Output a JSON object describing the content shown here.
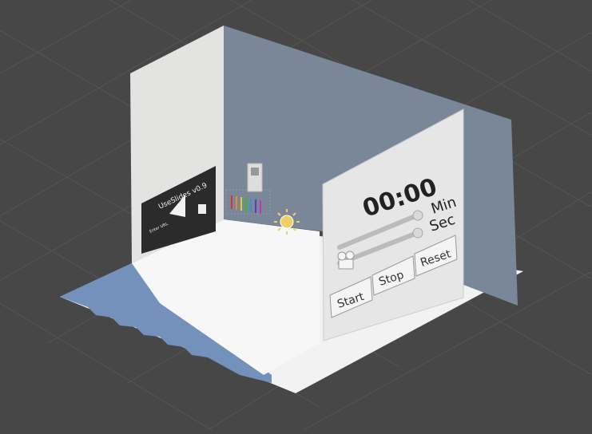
{
  "timer_panel": {
    "time_display": "00:00",
    "min_label": "Min",
    "sec_label": "Sec",
    "reset_label": "Reset",
    "stop_label": "Stop",
    "start_label": "Start"
  },
  "slides_screen": {
    "title": "UseSlides v0.9",
    "enter_url_label": "Enter URL"
  },
  "colors": {
    "background": "#474747",
    "grid": "#555555",
    "back_wall": "#7a8799",
    "side_wall": "#e3e3e1",
    "floor": "#f2f2f2",
    "shadow": "#6f89b0",
    "panel": "#e6e6e6",
    "light_gizmo": "#f0d060"
  },
  "icons": {
    "light": "sun-light-gizmo-icon",
    "camera": "camera-gizmo-icon"
  }
}
